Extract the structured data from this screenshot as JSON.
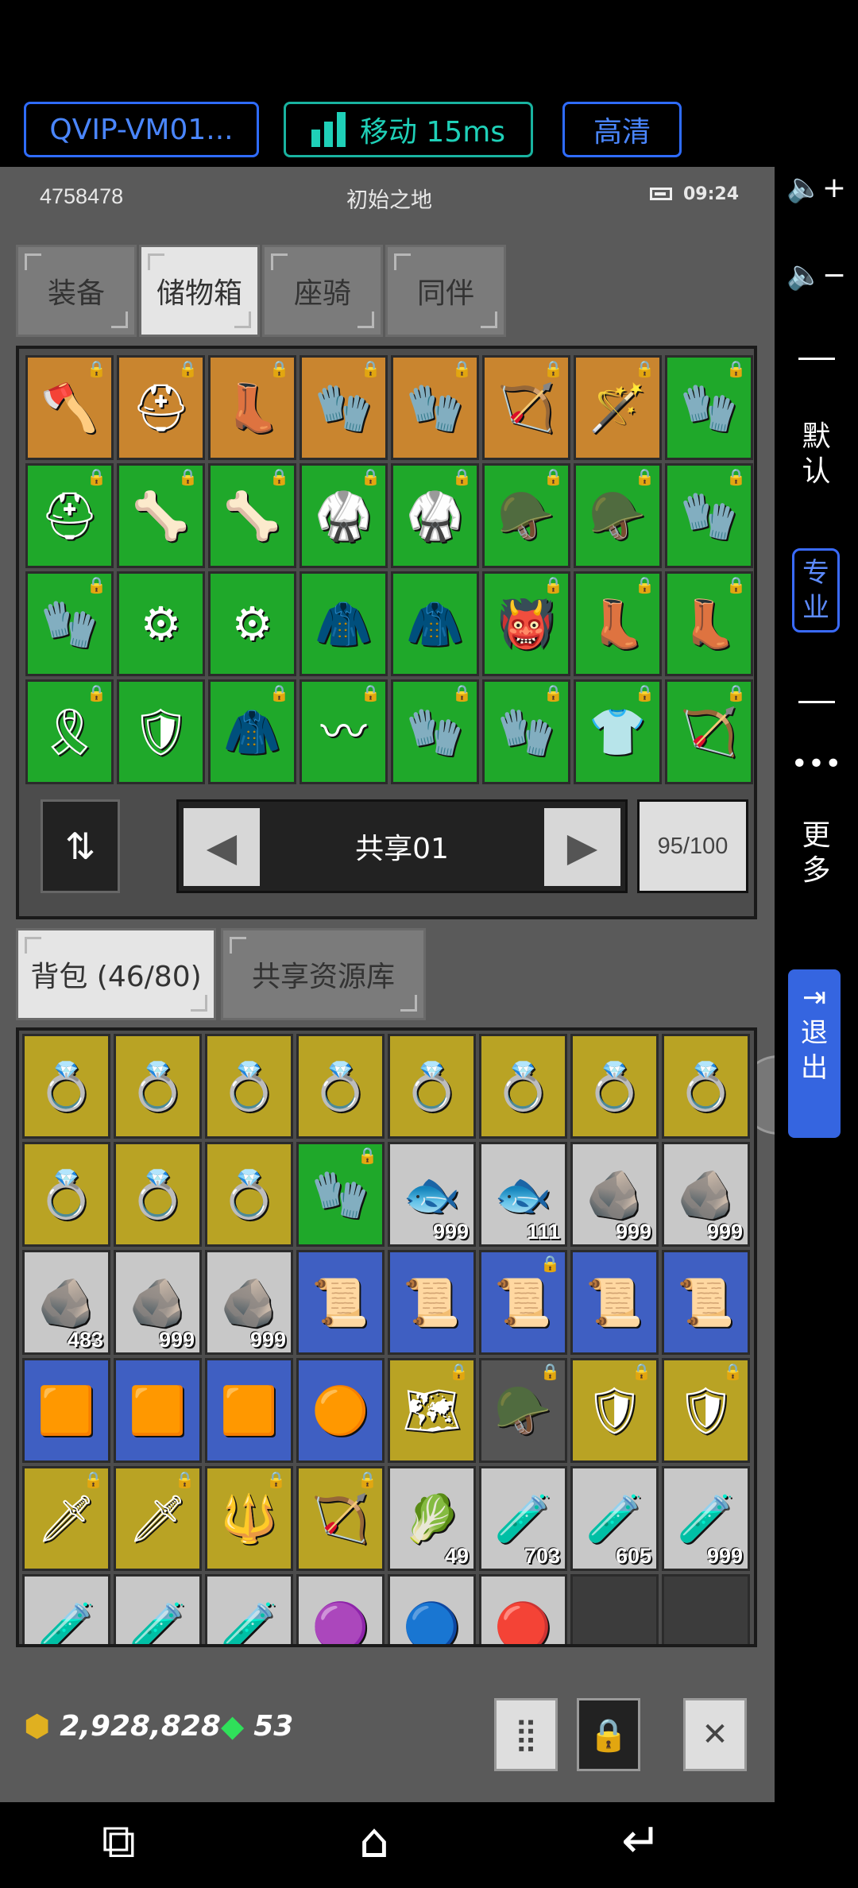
{
  "topbar": {
    "vip_label": "QVIP-VM01...",
    "network_label": "移动 15ms",
    "quality_label": "高清"
  },
  "status": {
    "player_id": "4758478",
    "location": "初始之地",
    "time": "09:24"
  },
  "top_tabs": [
    "装备",
    "储物箱",
    "座骑",
    "同伴"
  ],
  "top_tabs_active": "储物箱",
  "storage": {
    "rows": [
      [
        {
          "c": "orange",
          "g": "🪓",
          "l": true
        },
        {
          "c": "orange",
          "g": "⛑",
          "l": true
        },
        {
          "c": "orange",
          "g": "👢",
          "l": true
        },
        {
          "c": "orange",
          "g": "🧤",
          "l": true
        },
        {
          "c": "orange",
          "g": "🧤",
          "l": true
        },
        {
          "c": "orange",
          "g": "🏹",
          "l": true
        },
        {
          "c": "orange",
          "g": "🪄",
          "l": true
        },
        {
          "c": "green",
          "g": "🧤",
          "l": true
        }
      ],
      [
        {
          "c": "green",
          "g": "⛑",
          "l": true
        },
        {
          "c": "green",
          "g": "🦴",
          "l": true
        },
        {
          "c": "green",
          "g": "🦴",
          "l": true
        },
        {
          "c": "green",
          "g": "🥋",
          "l": true
        },
        {
          "c": "green",
          "g": "🥋",
          "l": true
        },
        {
          "c": "green",
          "g": "🪖",
          "l": true
        },
        {
          "c": "green",
          "g": "🪖",
          "l": true
        },
        {
          "c": "green",
          "g": "🧤",
          "l": true
        }
      ],
      [
        {
          "c": "green",
          "g": "🧤",
          "l": true
        },
        {
          "c": "green",
          "g": "⚙",
          "l": false
        },
        {
          "c": "green",
          "g": "⚙",
          "l": false
        },
        {
          "c": "green",
          "g": "🧥",
          "l": false
        },
        {
          "c": "green",
          "g": "🧥",
          "l": false
        },
        {
          "c": "green",
          "g": "👹",
          "l": true
        },
        {
          "c": "green",
          "g": "👢",
          "l": true
        },
        {
          "c": "green",
          "g": "👢",
          "l": true
        }
      ],
      [
        {
          "c": "green",
          "g": "🎗",
          "l": true
        },
        {
          "c": "green",
          "g": "🛡",
          "l": false
        },
        {
          "c": "green",
          "g": "🧥",
          "l": true
        },
        {
          "c": "green",
          "g": "〰",
          "l": true
        },
        {
          "c": "green",
          "g": "🧤",
          "l": true
        },
        {
          "c": "green",
          "g": "🧤",
          "l": true
        },
        {
          "c": "green",
          "g": "👕",
          "l": true
        },
        {
          "c": "green",
          "g": "🏹",
          "l": true
        }
      ]
    ],
    "page_name": "共享01",
    "capacity": "95/100"
  },
  "bottom_tabs": [
    "背包 (46/80)",
    "共享资源库"
  ],
  "bottom_tabs_active": "背包 (46/80)",
  "bag": {
    "rows": [
      [
        {
          "c": "yellow",
          "g": "💍"
        },
        {
          "c": "yellow",
          "g": "💍"
        },
        {
          "c": "yellow",
          "g": "💍"
        },
        {
          "c": "yellow",
          "g": "💍"
        },
        {
          "c": "yellow",
          "g": "💍"
        },
        {
          "c": "yellow",
          "g": "💍"
        },
        {
          "c": "yellow",
          "g": "💍"
        },
        {
          "c": "yellow",
          "g": "💍"
        }
      ],
      [
        {
          "c": "yellow",
          "g": "💍"
        },
        {
          "c": "yellow",
          "g": "💍"
        },
        {
          "c": "yellow",
          "g": "💍"
        },
        {
          "c": "green",
          "g": "🧤",
          "l": true
        },
        {
          "c": "gray",
          "g": "🐟",
          "q": "999"
        },
        {
          "c": "gray",
          "g": "🐟",
          "q": "111"
        },
        {
          "c": "gray",
          "g": "🪨",
          "q": "999"
        },
        {
          "c": "gray",
          "g": "🪨",
          "q": "999"
        }
      ],
      [
        {
          "c": "gray",
          "g": "🪨",
          "q": "483"
        },
        {
          "c": "gray",
          "g": "🪨",
          "q": "999"
        },
        {
          "c": "gray",
          "g": "🪨",
          "q": "999"
        },
        {
          "c": "blue",
          "g": "📜"
        },
        {
          "c": "blue",
          "g": "📜"
        },
        {
          "c": "blue",
          "g": "📜",
          "l": true
        },
        {
          "c": "blue",
          "g": "📜"
        },
        {
          "c": "blue",
          "g": "📜"
        }
      ],
      [
        {
          "c": "blue",
          "g": "🟧"
        },
        {
          "c": "blue",
          "g": "🟧"
        },
        {
          "c": "blue",
          "g": "🟧"
        },
        {
          "c": "blue",
          "g": "🟠"
        },
        {
          "c": "yellow",
          "g": "🗺",
          "l": true
        },
        {
          "c": "dgray",
          "g": "🪖",
          "l": true
        },
        {
          "c": "yellow",
          "g": "🛡",
          "l": true
        },
        {
          "c": "yellow",
          "g": "🛡",
          "l": true
        }
      ],
      [
        {
          "c": "yellow",
          "g": "🗡",
          "l": true
        },
        {
          "c": "yellow",
          "g": "🗡",
          "l": true
        },
        {
          "c": "yellow",
          "g": "🔱",
          "l": true
        },
        {
          "c": "yellow",
          "g": "🏹",
          "l": true
        },
        {
          "c": "gray",
          "g": "🥬",
          "q": "49"
        },
        {
          "c": "gray",
          "g": "🧪",
          "q": "703"
        },
        {
          "c": "gray",
          "g": "🧪",
          "q": "605"
        },
        {
          "c": "gray",
          "g": "🧪",
          "q": "999"
        }
      ],
      [
        {
          "c": "gray",
          "g": "🧪"
        },
        {
          "c": "gray",
          "g": "🧪"
        },
        {
          "c": "gray",
          "g": "🧪"
        },
        {
          "c": "gray",
          "g": "🟣"
        },
        {
          "c": "gray",
          "g": "🔵"
        },
        {
          "c": "gray",
          "g": "🔴"
        },
        {
          "c": "dark",
          "g": ""
        },
        {
          "c": "dark",
          "g": ""
        }
      ]
    ]
  },
  "footer": {
    "gold": "2,928,828",
    "gems": "53"
  },
  "side": {
    "default_label": "默认",
    "pro_label": "专业",
    "more_label": "更多",
    "exit_label": "退出"
  },
  "colors": {
    "orange": "#c9852f",
    "green": "#1fa82a",
    "yellow": "#b9a324",
    "blue": "#3f5fc2",
    "accent": "#3565e0"
  }
}
